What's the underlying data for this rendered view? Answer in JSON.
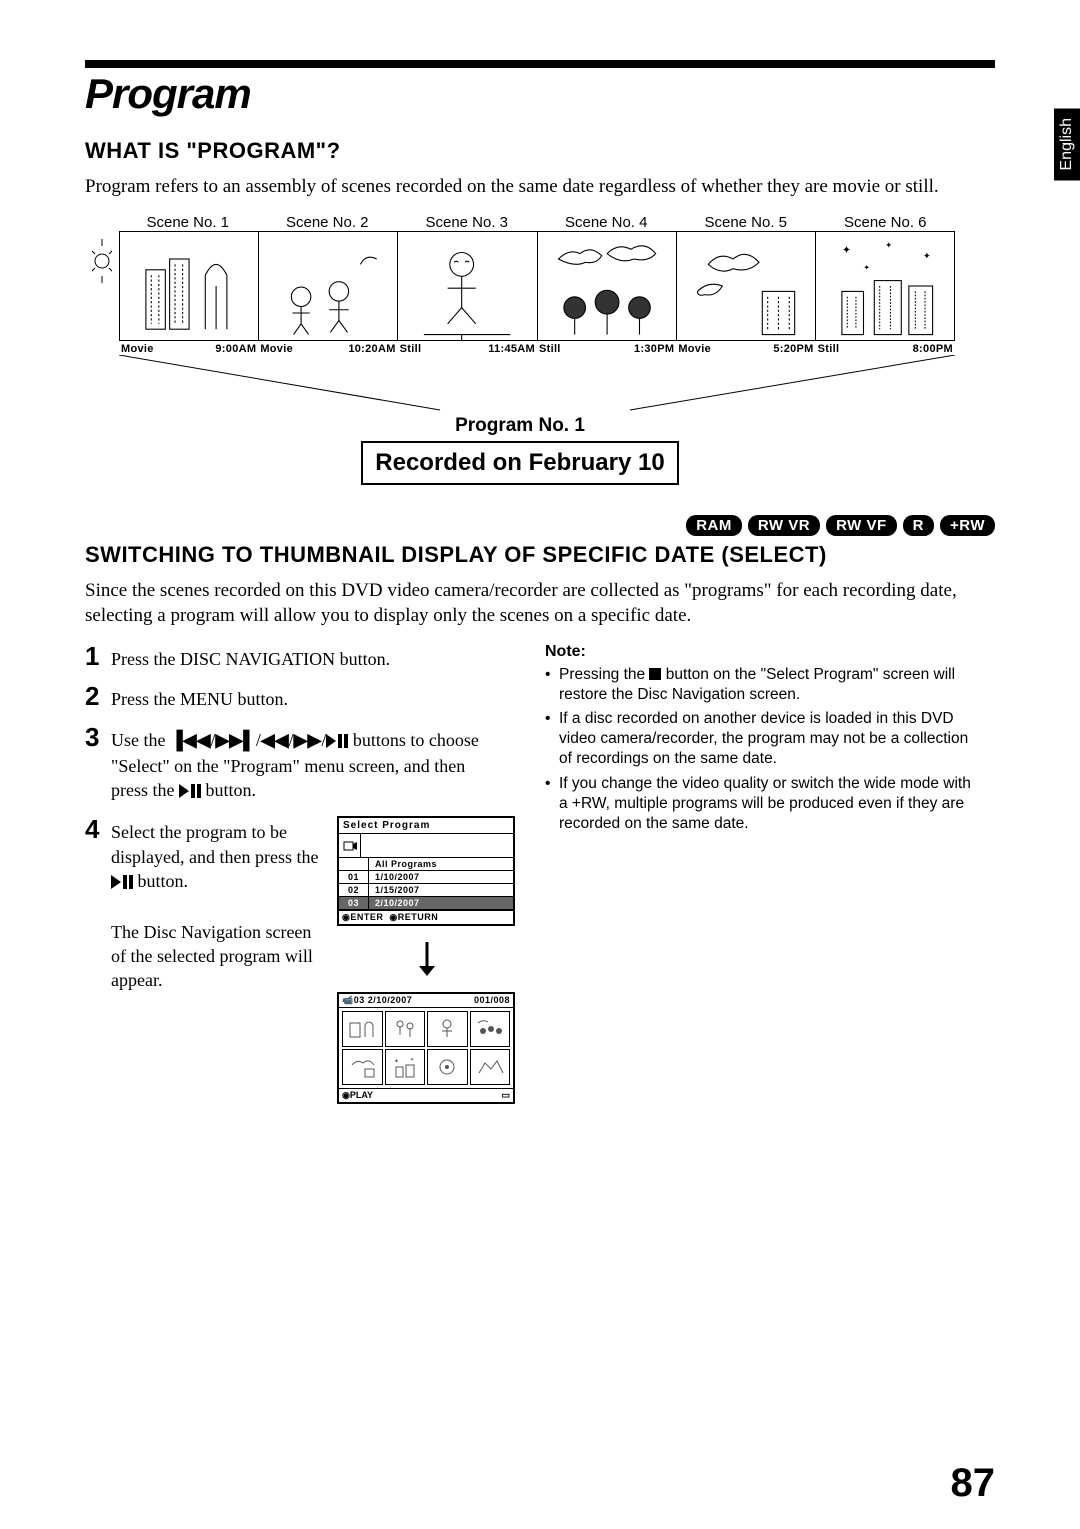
{
  "lang_tab": "English",
  "page_title": "Program",
  "section1": {
    "heading": "WHAT IS \"PROGRAM\"?",
    "body": "Program refers to an assembly of scenes recorded on the same date regardless of whether they are movie or still."
  },
  "diagram": {
    "scene_labels": [
      "Scene No. 1",
      "Scene No. 2",
      "Scene No. 3",
      "Scene No. 4",
      "Scene No. 5",
      "Scene No. 6"
    ],
    "timeline": [
      {
        "type": "Movie",
        "time": "9:00AM"
      },
      {
        "type": "Movie",
        "time": "10:20AM"
      },
      {
        "type": "Still",
        "time": "11:45AM"
      },
      {
        "type": "Still",
        "time": "1:30PM"
      },
      {
        "type": "Movie",
        "time": "5:20PM"
      },
      {
        "type": "Still",
        "time": "8:00PM"
      }
    ],
    "program_no": "Program No. 1",
    "recorded_on": "Recorded on February 10"
  },
  "badges": [
    "RAM",
    "RW VR",
    "RW VF",
    "R",
    "+RW"
  ],
  "section2": {
    "heading": "SWITCHING TO THUMBNAIL DISPLAY OF SPECIFIC DATE (SELECT)",
    "body": "Since the scenes recorded on this DVD video camera/recorder are collected as \"programs\" for each recording date, selecting a program will allow you to display only the scenes on a specific date."
  },
  "steps": {
    "s1": "Press the DISC NAVIGATION button.",
    "s2": "Press the MENU button.",
    "s3_a": "Use the ",
    "s3_b": " buttons to choose \"Select\" on the \"Program\" menu screen, and then press the ",
    "s3_c": " button.",
    "s4_a": "Select the program to be displayed, and then press the ",
    "s4_b": " button.",
    "s4_c": "The Disc Navigation screen of the selected program will appear."
  },
  "select_screen": {
    "title": "Select Program",
    "head": "All Programs",
    "rows": [
      {
        "n": "01",
        "d": "1/10/2007"
      },
      {
        "n": "02",
        "d": "1/15/2007"
      },
      {
        "n": "03",
        "d": "2/10/2007"
      }
    ],
    "foot_enter": "ENTER",
    "foot_return": "RETURN"
  },
  "thumb_screen": {
    "left": "03   2/10/2007",
    "right": "001/008",
    "foot_left": "PLAY"
  },
  "note": {
    "head": "Note:",
    "items": [
      {
        "pre": "Pressing the ",
        "post": " button on the \"Select Program\" screen will restore the Disc Navigation screen."
      },
      {
        "text": "If a disc recorded on another device is loaded in this DVD video camera/recorder, the program may not be a collection of recordings on the same date."
      },
      {
        "text": "If you change the video quality or switch the wide mode with a +RW, multiple programs will be produced even if they are recorded on the same date."
      }
    ]
  },
  "page_number": "87"
}
